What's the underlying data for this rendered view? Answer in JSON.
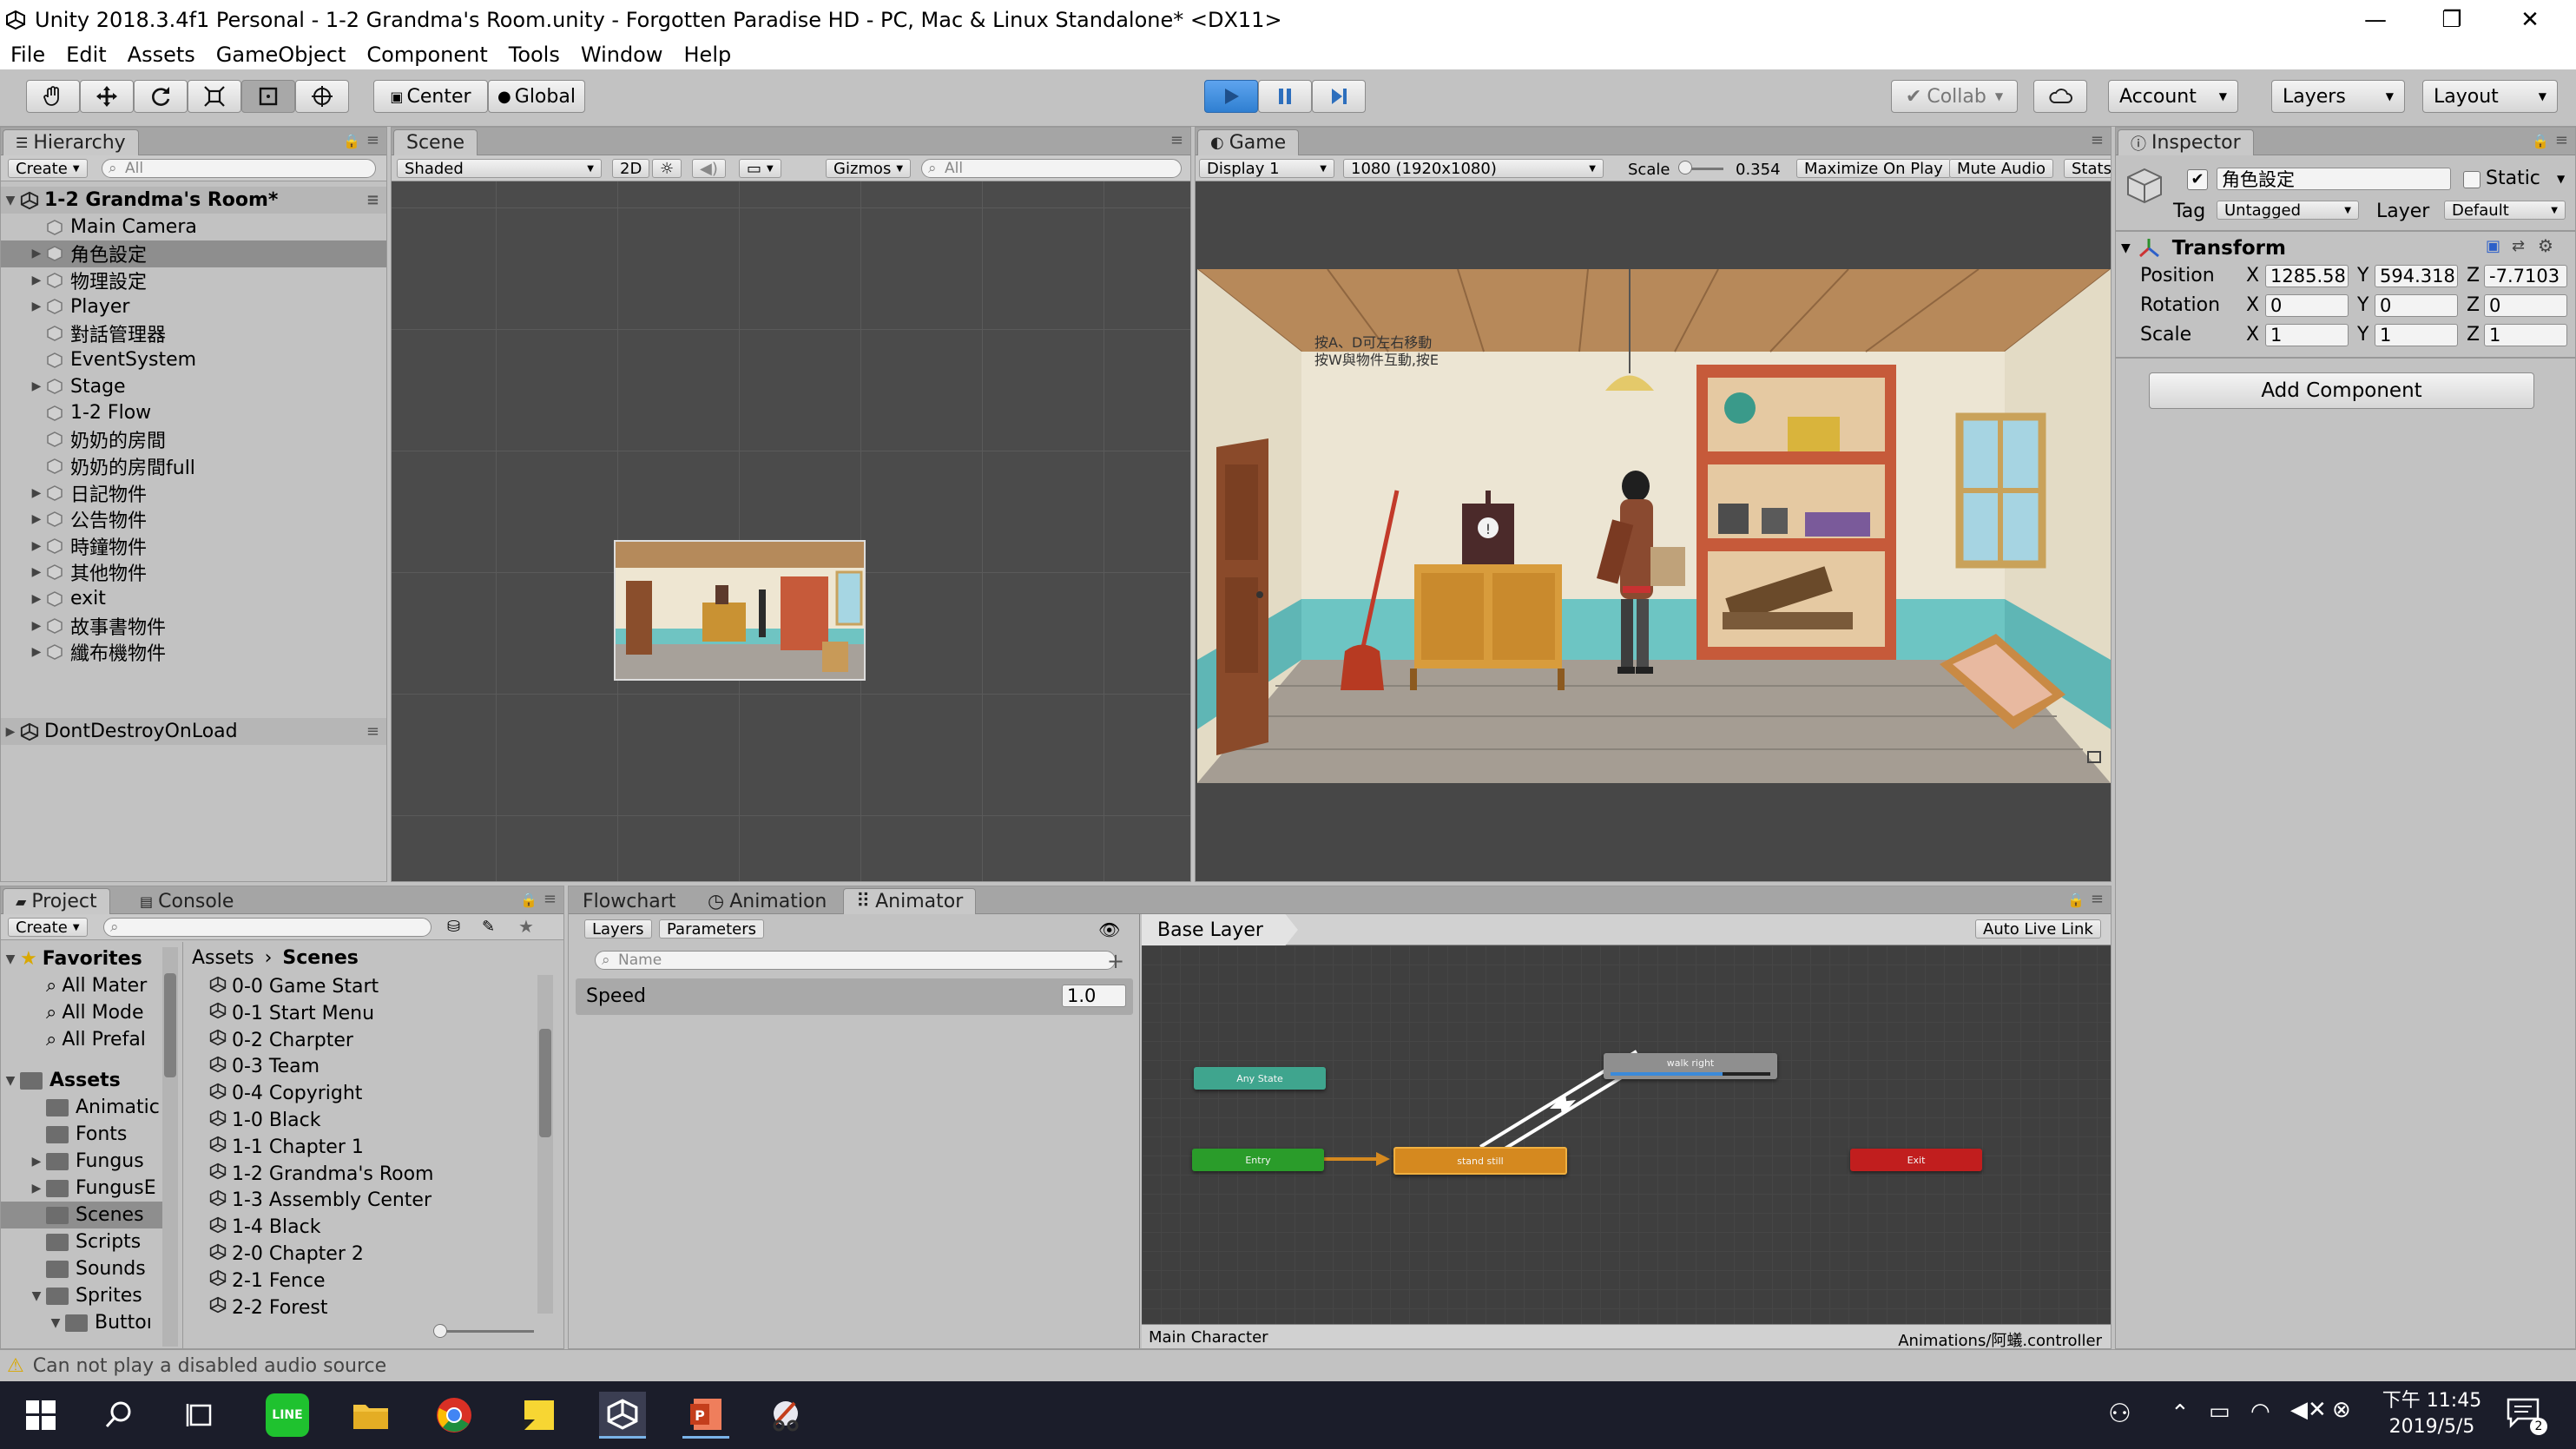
{
  "window": {
    "title": "Unity 2018.3.4f1 Personal - 1-2 Grandma's Room.unity - Forgotten Paradise HD - PC, Mac & Linux Standalone* <DX11>",
    "minimize": "—",
    "maximize": "❐",
    "close": "✕"
  },
  "menu": [
    "File",
    "Edit",
    "Assets",
    "GameObject",
    "Component",
    "Tools",
    "Window",
    "Help"
  ],
  "toolbar": {
    "pivot": "Center",
    "space": "Global",
    "collab": "Collab",
    "account": "Account",
    "layers": "Layers",
    "layout": "Layout"
  },
  "hierarchy": {
    "tab": "Hierarchy",
    "create": "Create",
    "search_placeholder": "All",
    "scene": "1-2 Grandma's Room*",
    "items": [
      {
        "label": "Main Camera",
        "expand": false,
        "selected": false
      },
      {
        "label": "角色設定",
        "expand": true,
        "selected": true
      },
      {
        "label": "物理設定",
        "expand": true,
        "selected": false
      },
      {
        "label": "Player",
        "expand": true,
        "selected": false
      },
      {
        "label": "對話管理器",
        "expand": false,
        "selected": false
      },
      {
        "label": "EventSystem",
        "expand": false,
        "selected": false
      },
      {
        "label": "Stage",
        "expand": true,
        "selected": false
      },
      {
        "label": "1-2 Flow",
        "expand": false,
        "selected": false
      },
      {
        "label": "奶奶的房間",
        "expand": false,
        "selected": false
      },
      {
        "label": "奶奶的房間full",
        "expand": false,
        "selected": false
      },
      {
        "label": "日記物件",
        "expand": true,
        "selected": false
      },
      {
        "label": "公告物件",
        "expand": true,
        "selected": false
      },
      {
        "label": "時鐘物件",
        "expand": true,
        "selected": false
      },
      {
        "label": "其他物件",
        "expand": true,
        "selected": false
      },
      {
        "label": "exit",
        "expand": true,
        "selected": false
      },
      {
        "label": "故事書物件",
        "expand": true,
        "selected": false
      },
      {
        "label": "纖布機物件",
        "expand": true,
        "selected": false
      }
    ],
    "dontdestroy": "DontDestroyOnLoad"
  },
  "scene": {
    "tab": "Scene",
    "shading": "Shaded",
    "mode2d": "2D",
    "gizmos": "Gizmos",
    "search_placeholder": "All"
  },
  "game": {
    "tab": "Game",
    "display": "Display 1",
    "resolution": "1080 (1920x1080)",
    "scale_label": "Scale",
    "scale_value": "0.354",
    "maximize": "Maximize On Play",
    "mute": "Mute Audio",
    "stats": "Stats",
    "hint_line1": "按A、D可左右移動",
    "hint_line2": "按W與物件互動,按E",
    "clock_glyph": "!"
  },
  "inspector": {
    "tab": "Inspector",
    "object_name": "角色設定",
    "static": "Static",
    "tag_label": "Tag",
    "tag_value": "Untagged",
    "layer_label": "Layer",
    "layer_value": "Default",
    "transform": "Transform",
    "position_label": "Position",
    "rotation_label": "Rotation",
    "scale_label": "Scale",
    "axis_x": "X",
    "axis_y": "Y",
    "axis_z": "Z",
    "pos_x": "1285.58",
    "pos_y": "594.318",
    "pos_z": "-7.7103",
    "rot_x": "0",
    "rot_y": "0",
    "rot_z": "0",
    "scl_x": "1",
    "scl_y": "1",
    "scl_z": "1",
    "add_component": "Add Component"
  },
  "project": {
    "tab_project": "Project",
    "tab_console": "Console",
    "create": "Create",
    "favorites": "Favorites",
    "fav_items": [
      "All Mater",
      "All Mode",
      "All Prefal"
    ],
    "assets": "Assets",
    "asset_folders": [
      {
        "label": "Animatic",
        "expand": false
      },
      {
        "label": "Fonts",
        "expand": false
      },
      {
        "label": "Fungus",
        "expand": true
      },
      {
        "label": "FungusE",
        "expand": true
      },
      {
        "label": "Scenes",
        "expand": false
      },
      {
        "label": "Scripts",
        "expand": false
      },
      {
        "label": "Sounds",
        "expand": false
      },
      {
        "label": "Sprites",
        "expand": true
      },
      {
        "label": "Buttoı",
        "expand": true
      }
    ],
    "breadcrumb_root": "Assets",
    "breadcrumb_sep": "›",
    "breadcrumb_current": "Scenes",
    "scenes": [
      "0-0 Game Start",
      "0-1 Start Menu",
      "0-2 Charpter",
      "0-3 Team",
      "0-4 Copyright",
      "1-0 Black",
      "1-1 Chapter 1",
      "1-2 Grandma's Room",
      "1-3 Assembly Center",
      "1-4 Black",
      "2-0 Chapter 2",
      "2-1 Fence",
      "2-2 Forest"
    ]
  },
  "animator": {
    "tab_flowchart": "Flowchart",
    "tab_animation": "Animation",
    "tab_animator": "Animator",
    "layers": "Layers",
    "parameters": "Parameters",
    "search_placeholder": "Name",
    "param_name": "Speed",
    "param_value": "1.0",
    "base_layer": "Base Layer",
    "auto_live_link": "Auto Live Link",
    "nodes": {
      "any": "Any State",
      "entry": "Entry",
      "stand": "stand still",
      "walk": "walk right",
      "exit": "Exit"
    },
    "footer_left": "Main Character",
    "footer_right": "Animations/阿蟻.controller"
  },
  "status": {
    "message": "Can not play a disabled audio source"
  },
  "taskbar": {
    "time": "下午 11:45",
    "date": "2019/5/5",
    "notify_count": "2"
  },
  "colors": {
    "unity_bg": "#c2c2c2",
    "play_active": "#3b8ad9",
    "node_any": "#3fa58e",
    "node_entry": "#2a9c2a",
    "node_stand": "#d5891f",
    "node_walk": "#8f8f8f",
    "node_exit": "#c11e1e",
    "taskbar": "#1b1d2a"
  }
}
